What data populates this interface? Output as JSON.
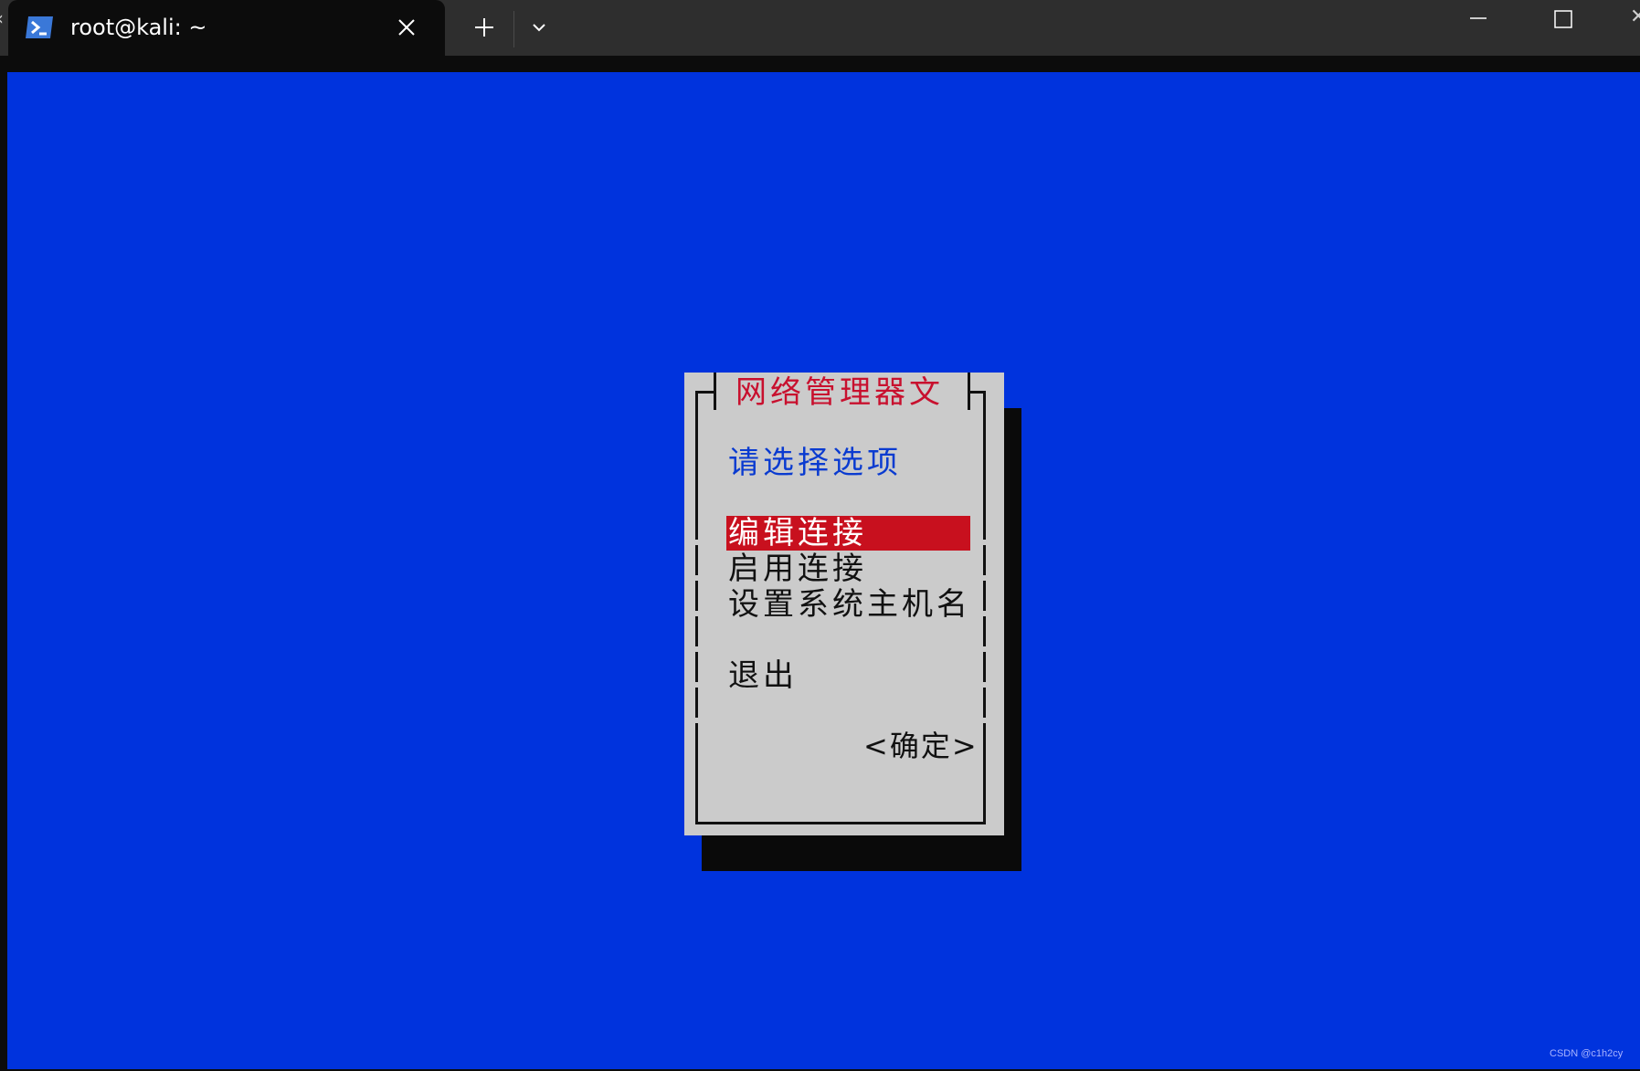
{
  "window": {
    "tab_title": "root@kali: ~"
  },
  "dialog": {
    "title": "网络管理器文",
    "prompt": "请选择选项",
    "menu_items": [
      {
        "label": "编辑连接",
        "selected": true
      },
      {
        "label": "启用连接",
        "selected": false
      },
      {
        "label": "设置系统主机名",
        "selected": false
      },
      {
        "label": "退出",
        "selected": false
      }
    ],
    "ok_button": "<确定>"
  },
  "watermark": "CSDN @c1h2cy",
  "colors": {
    "screen_background": "#0033dd",
    "dialog_background": "#cbcbcb",
    "title_text": "#c8102e",
    "prompt_text": "#0a3bd0",
    "selection_background": "#c8101e"
  },
  "icons": {
    "tab_icon": "powershell-icon",
    "close": "close-icon",
    "new_tab": "plus-icon",
    "dropdown": "chevron-down-icon",
    "minimize": "minimize-icon",
    "maximize": "maximize-icon"
  }
}
